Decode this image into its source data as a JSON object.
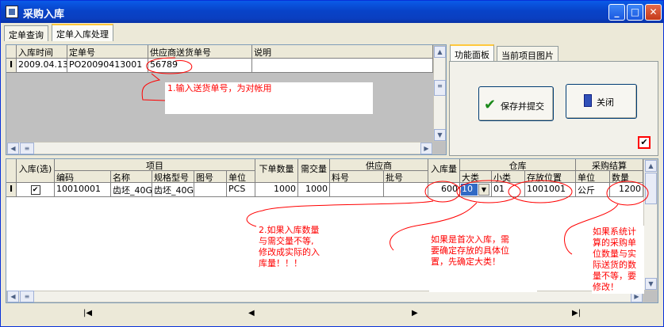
{
  "window": {
    "title": "采购入库",
    "min": "_",
    "max": "□",
    "close": "✕"
  },
  "tabs": [
    "定单查询",
    "定单入库处理"
  ],
  "order_grid": {
    "headers": [
      "入库时间",
      "定单号",
      "供应商送货单号",
      "说明"
    ],
    "row": {
      "indicator": "I",
      "date": "2009.04.13",
      "order_no": "PO20090413001",
      "supplier_no": "56789",
      "remark": ""
    }
  },
  "side_tabs": [
    "功能面板",
    "当前项目图片"
  ],
  "buttons": {
    "submit": "保存并提交",
    "close": "关闭"
  },
  "checkbox_mark": "✔",
  "notes": {
    "n1": "1.输入送货单号，为对帐用",
    "n2_lines": [
      "2.如果入库数量",
      "与需交量不等,",
      "修改成实际的入",
      "库量！！！"
    ],
    "n3_lines": [
      "如果是首次入库，需",
      "要确定存放的具体位",
      "置，先确定大类！"
    ],
    "n4_lines": [
      "如果系统计",
      "算的采购单",
      "位数量与实",
      "际送货的数",
      "量不等，要",
      "修改！"
    ]
  },
  "detail_grid": {
    "group_headers": {
      "item": "项目",
      "supplier": "供应商",
      "warehouse": "仓库",
      "purchase": "采购结算"
    },
    "headers": {
      "select": "入库(选)",
      "code": "编码",
      "name": "名称",
      "spec": "规格型号",
      "drawing": "图号",
      "unit": "单位",
      "order_qty": "下单数量",
      "need_qty": "需交量",
      "part_no": "料号",
      "batch": "批号",
      "in_qty": "入库量",
      "major": "大类",
      "minor": "小类",
      "location": "存放位置",
      "p_unit": "单位",
      "p_qty": "数量"
    },
    "row": {
      "indicator": "I",
      "checked": "✔",
      "code": "10010001",
      "name": "齿坯_40G",
      "spec": "齿坯_40G",
      "drawing": "",
      "unit": "PCS",
      "order_qty": "1000",
      "need_qty": "1000",
      "part_no": "",
      "batch": "",
      "in_qty": "600",
      "major": "10",
      "minor": "01",
      "location": "1001001",
      "p_unit": "公斤",
      "p_qty": "1200"
    }
  },
  "nav": {
    "first": "|◀",
    "prev": "◀",
    "next": "▶",
    "last": "▶|"
  },
  "colors": {
    "title_blue": "#0a4fd8",
    "note_red": "#ff0000",
    "select_blue": "#316ac5"
  }
}
